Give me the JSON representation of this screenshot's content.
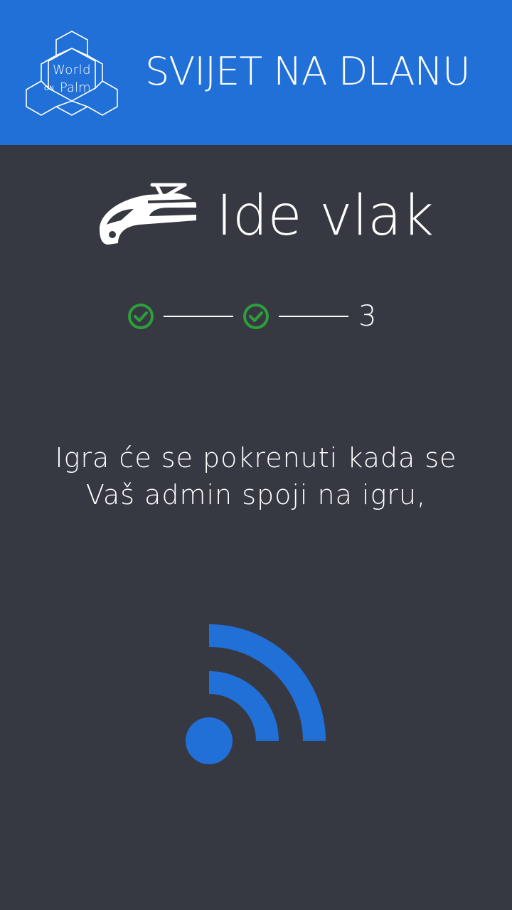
{
  "header": {
    "logo": {
      "word_world": "World",
      "word_on": "ON",
      "word_palm": "Palm"
    },
    "title": "SVIJET NA DLANU",
    "background_color": "#2070d8"
  },
  "game": {
    "icon": "train-icon",
    "title": "Ide vlak"
  },
  "stepper": {
    "steps": [
      {
        "state": "done",
        "icon": "check-circle-icon"
      },
      {
        "state": "done",
        "icon": "check-circle-icon"
      },
      {
        "state": "current",
        "label": "3"
      }
    ],
    "done_color": "#2e9e3a"
  },
  "status": {
    "message": "Igra će se pokrenuti kada se Vaš admin spoji na igru,",
    "icon": "wifi-signal-icon",
    "icon_color": "#2070d8"
  }
}
